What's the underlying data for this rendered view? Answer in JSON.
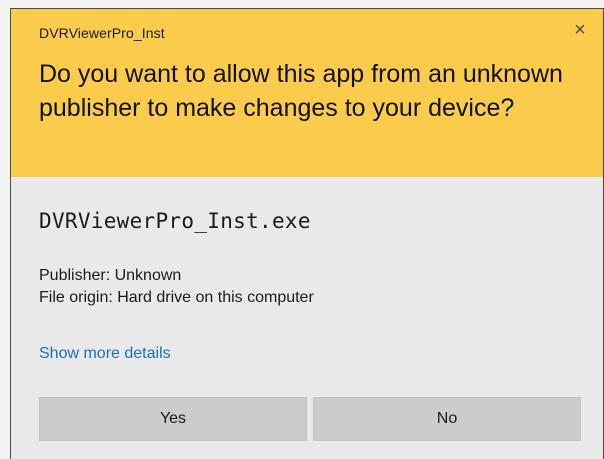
{
  "dialog": {
    "app_name": "DVRViewerPro_Inst",
    "close_glyph": "×",
    "question": "Do you want to allow this app from an unknown publisher to make changes to your device?",
    "file_name": "DVRViewerPro_Inst.exe",
    "publisher": "Publisher: Unknown",
    "file_origin": "File origin: Hard drive on this computer",
    "details_link": "Show more details",
    "buttons": {
      "yes": "Yes",
      "no": "No"
    },
    "colors": {
      "header_bg": "#fbcb4b",
      "body_bg": "#e9e9e9",
      "button_bg": "#cccccc",
      "link": "#1e6fb8"
    },
    "icons": {
      "close": "close-icon"
    }
  }
}
